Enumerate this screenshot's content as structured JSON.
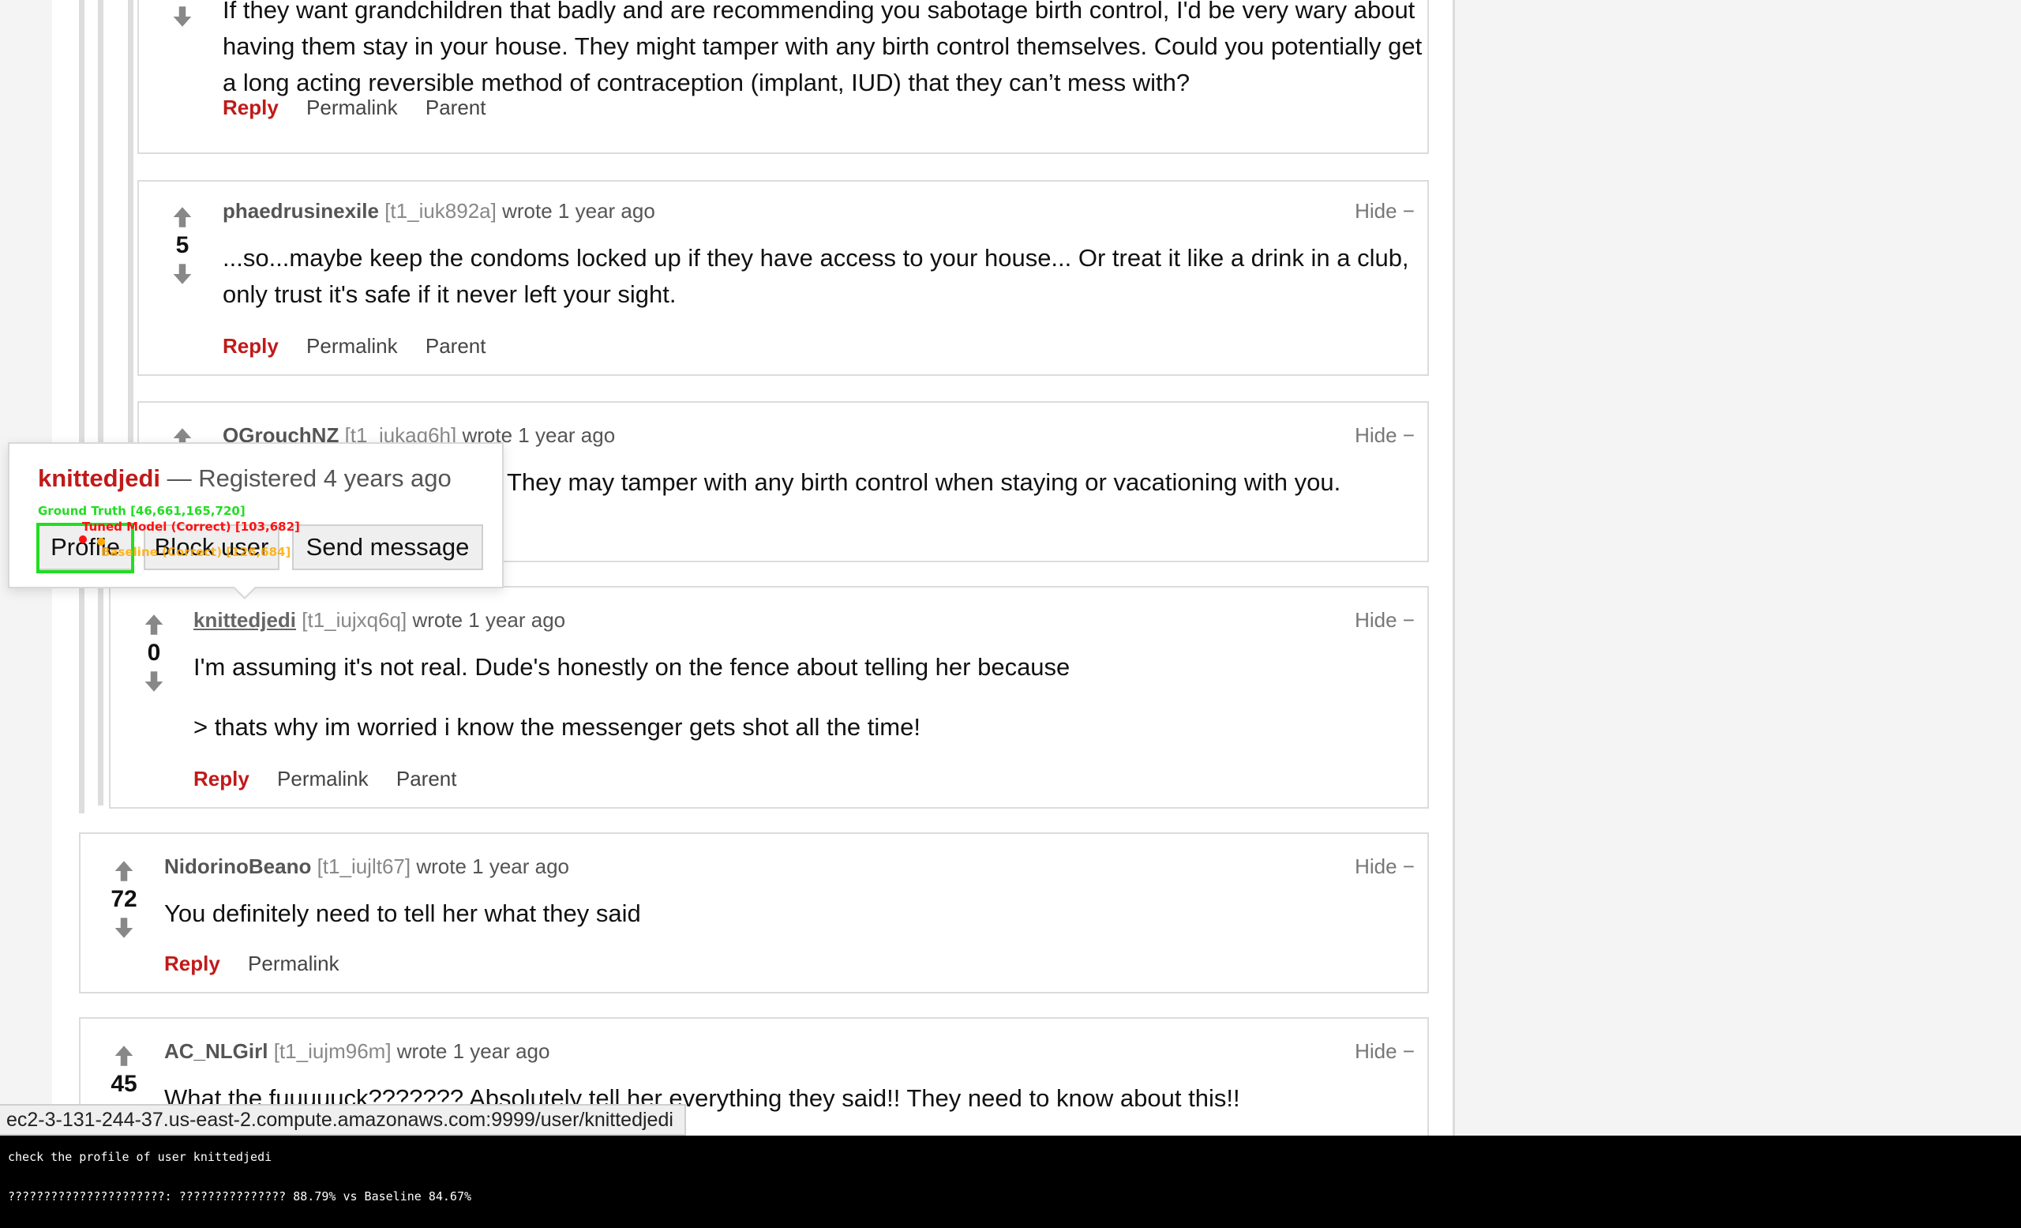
{
  "comments": [
    {
      "body_lines": [
        "If they want grandchildren that badly and are recommending you sabotage birth control, I'd be very wary about",
        "having them stay in your house. They might tamper with any birth control themselves. Could you potentially get",
        "a long acting reversible method of contraception (implant, IUD) that they can’t mess with?"
      ],
      "reply": "Reply",
      "permalink": "Permalink",
      "parent": "Parent"
    },
    {
      "user": "phaedrusinexile",
      "tid": "[t1_iuk892a]",
      "wrote": "wrote",
      "time": "1 year ago",
      "score": "5",
      "hide": "Hide −",
      "body_lines": [
        "...so...maybe keep the condoms locked up if they have access to your house... Or treat it like a drink in a club,",
        "only trust it's safe if it never left your sight."
      ],
      "reply": "Reply",
      "permalink": "Permalink",
      "parent": "Parent"
    },
    {
      "user": "OGrouchNZ",
      "tid": "[t1_iukaq6h]",
      "wrote": "wrote",
      "time": "1 year ago",
      "hide": "Hide −",
      "body_fragment": "They may tamper with any birth control when staying or vacationing with you."
    },
    {
      "user": "knittedjedi",
      "tid": "[t1_iujxq6q]",
      "wrote": "wrote",
      "time": "1 year ago",
      "score": "0",
      "hide": "Hide −",
      "body_p1": "I'm assuming it's not real. Dude's honestly on the fence about telling her because",
      "body_p2": "> thats why im worried i know the messenger gets shot all the time!",
      "reply": "Reply",
      "permalink": "Permalink",
      "parent": "Parent"
    },
    {
      "user": "NidorinoBeano",
      "tid": "[t1_iujlt67]",
      "wrote": "wrote",
      "time": "1 year ago",
      "score": "72",
      "hide": "Hide −",
      "body": "You definitely need to tell her what they said",
      "reply": "Reply",
      "permalink": "Permalink"
    },
    {
      "user": "AC_NLGirl",
      "tid": "[t1_iujm96m]",
      "wrote": "wrote",
      "time": "1 year ago",
      "score": "45",
      "hide": "Hide −",
      "body": "What the fuuuuuck??????? Absolutely tell her everything they said!! They need to know about this!!"
    }
  ],
  "popup": {
    "username": "knittedjedi",
    "registered": "— Registered 4 years ago",
    "profile_label": "Profile",
    "block_label": "Block user",
    "message_label": "Send message"
  },
  "overlay": {
    "ground_truth": "Ground Truth [46,661,165,720]",
    "tuned": "Tuned Model (Correct) [103,682]",
    "baseline": "Baseline (Correct) [126,684]",
    "colors": {
      "ground_truth": "#22dd22",
      "tuned": "#ff1111",
      "baseline": "#ffaa00"
    }
  },
  "status_url": "ec2-3-131-244-37.us-east-2.compute.amazonaws.com:9999/user/knittedjedi",
  "terminal": {
    "instruction": "check the profile of user knittedjedi",
    "result": "??????????????????????: ??????????????? 88.79% vs Baseline 84.67%"
  }
}
